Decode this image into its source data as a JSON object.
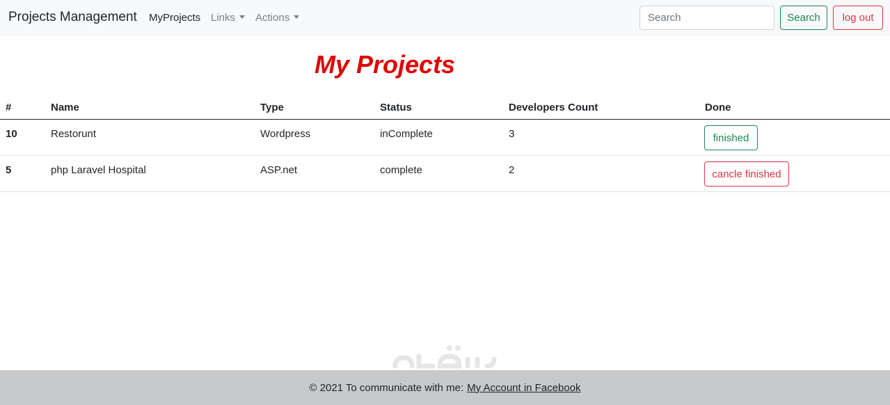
{
  "navbar": {
    "brand": "Projects Management",
    "links": [
      {
        "label": "MyProjects"
      },
      {
        "label": "Links"
      },
      {
        "label": "Actions"
      }
    ],
    "search_placeholder": "Search",
    "search_button": "Search",
    "logout_button": "log out"
  },
  "main": {
    "title": "My Projects",
    "table": {
      "headers": [
        "#",
        "Name",
        "Type",
        "Status",
        "Developers Count",
        "Done"
      ],
      "rows": [
        {
          "id": "10",
          "name": "Restorunt",
          "type": "Wordpress",
          "status": "inComplete",
          "dev_count": "3",
          "action": "finished"
        },
        {
          "id": "5",
          "name": "php Laravel Hospital",
          "type": "ASP.net",
          "status": "complete",
          "dev_count": "2",
          "action": "cancle finished"
        }
      ]
    }
  },
  "footer": {
    "text": "© 2021 To communicate with me:",
    "link": "My Account in Facebook"
  },
  "colors": {
    "title": "#e00000",
    "success": "#198754",
    "danger": "#dc3545",
    "navbar_bg": "#f8f9fa",
    "footer_bg": "#c8c9cb"
  }
}
